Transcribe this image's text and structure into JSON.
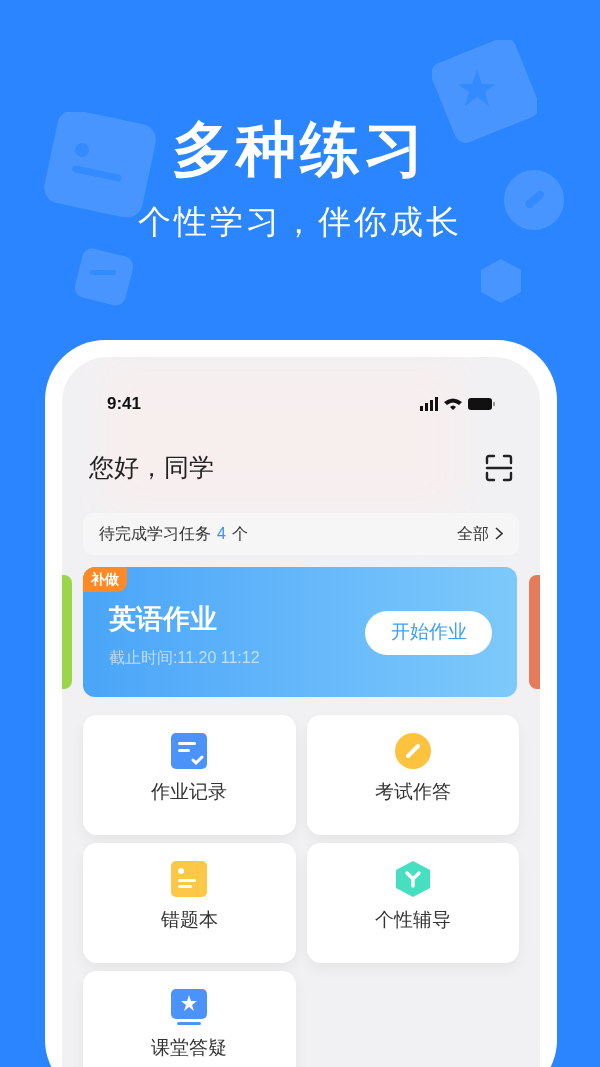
{
  "promo": {
    "title": "多种练习",
    "subtitle": "个性学习，伴你成长"
  },
  "status_bar": {
    "time": "9:41"
  },
  "header": {
    "greeting": "您好，同学"
  },
  "tasks": {
    "label": "待完成学习任务",
    "count": "4",
    "unit": "个",
    "link": "全部"
  },
  "task_card": {
    "badge": "补做",
    "title": "英语作业",
    "deadline": "截止时间:11.20 11:12",
    "button": "开始作业"
  },
  "menu": [
    {
      "kind": "record",
      "label": "作业记录"
    },
    {
      "kind": "exam",
      "label": "考试作答"
    },
    {
      "kind": "mistakes",
      "label": "错题本"
    },
    {
      "kind": "tutoring",
      "label": "个性辅导"
    },
    {
      "kind": "qa",
      "label": "课堂答疑"
    }
  ]
}
